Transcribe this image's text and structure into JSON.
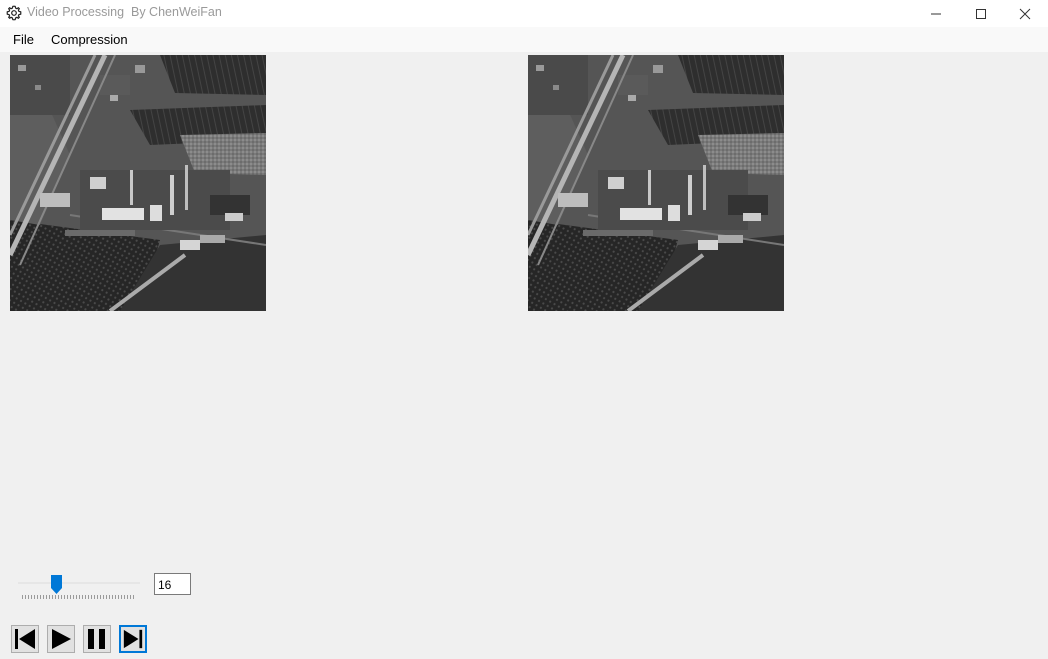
{
  "window": {
    "title": "Video Processing  By ChenWeiFan",
    "app_icon": "gear-icon",
    "controls": [
      "minimize-icon",
      "maximize-icon",
      "close-icon"
    ]
  },
  "menu": {
    "items": [
      {
        "label": "File"
      },
      {
        "label": "Compression"
      }
    ]
  },
  "frames": {
    "original_alt": "aerial grayscale video frame (original)",
    "processed_alt": "aerial grayscale video frame (processed)"
  },
  "playback": {
    "slider_position_fraction": 0.3,
    "frame_number": "16",
    "buttons": [
      {
        "icon": "skip-to-start-icon"
      },
      {
        "icon": "play-icon"
      },
      {
        "icon": "pause-icon"
      },
      {
        "icon": "skip-to-end-icon"
      }
    ]
  },
  "colors": {
    "accent": "#0078d7",
    "window_background": "#f0f0f0"
  }
}
